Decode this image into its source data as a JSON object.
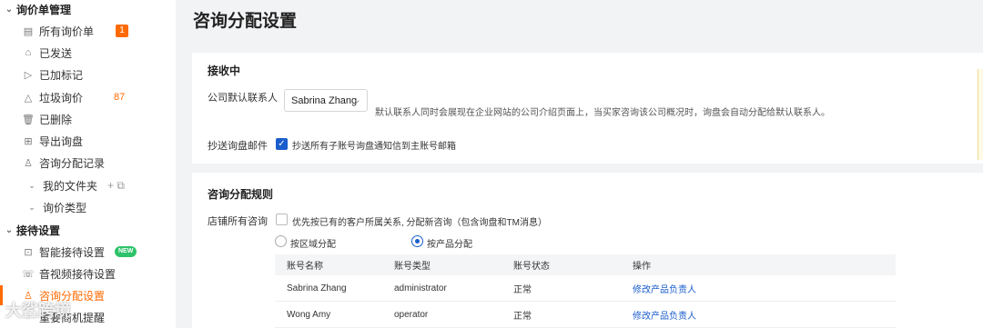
{
  "sidebar": {
    "inquiry_section": "询价单管理",
    "items": {
      "all": {
        "label": "所有询价单",
        "badge": "1"
      },
      "sent": {
        "label": "已发送"
      },
      "marked": {
        "label": "已加标记"
      },
      "spam": {
        "label": "垃圾询价",
        "count": "87"
      },
      "deleted": {
        "label": "已删除"
      },
      "export": {
        "label": "导出询盘"
      },
      "dist_records": {
        "label": "咨询分配记录"
      },
      "my_folders": {
        "label": "我的文件夹",
        "tools": "+ ⧉"
      },
      "inquiry_types": {
        "label": "询价类型"
      }
    },
    "reception_section": "接待设置",
    "reception_items": {
      "smart": {
        "label": "智能接待设置",
        "tag": "NEW"
      },
      "av": {
        "label": "音视频接待设置"
      },
      "distribution": {
        "label": "咨询分配设置"
      },
      "important": {
        "label": "重要商机提醒"
      }
    }
  },
  "page": {
    "title": "咨询分配设置"
  },
  "receiving": {
    "title": "接收中",
    "default_contact_label": "公司默认联系人",
    "default_contact_value": "Sabrina Zhang",
    "hint": "默认联系人同时会展现在企业网站的公司介绍页面上，当买家咨询该公司概况时，询盘会自动分配给默认联系人。",
    "cc_label": "抄送询盘邮件",
    "cc_option": "抄送所有子账号询盘通知信到主账号邮箱",
    "cc_checked": true
  },
  "rules": {
    "title": "咨询分配规则",
    "store_label": "店铺所有咨询",
    "priority_option": "优先按已有的客户所属关系, 分配新咨询（包含询盘和TM消息）",
    "priority_checked": false,
    "radio_region": "按区域分配",
    "radio_product": "按产品分配",
    "selected": "product",
    "table": {
      "headers": [
        "账号名称",
        "账号类型",
        "账号状态",
        "操作"
      ],
      "rows": [
        {
          "name": "Sabrina Zhang",
          "type": "administrator",
          "status": "正常",
          "action": "修改产品负责人"
        },
        {
          "name": "Wong Amy",
          "type": "operator",
          "status": "正常",
          "action": "修改产品负责人"
        }
      ]
    }
  },
  "watermark": "大鲨跨境"
}
